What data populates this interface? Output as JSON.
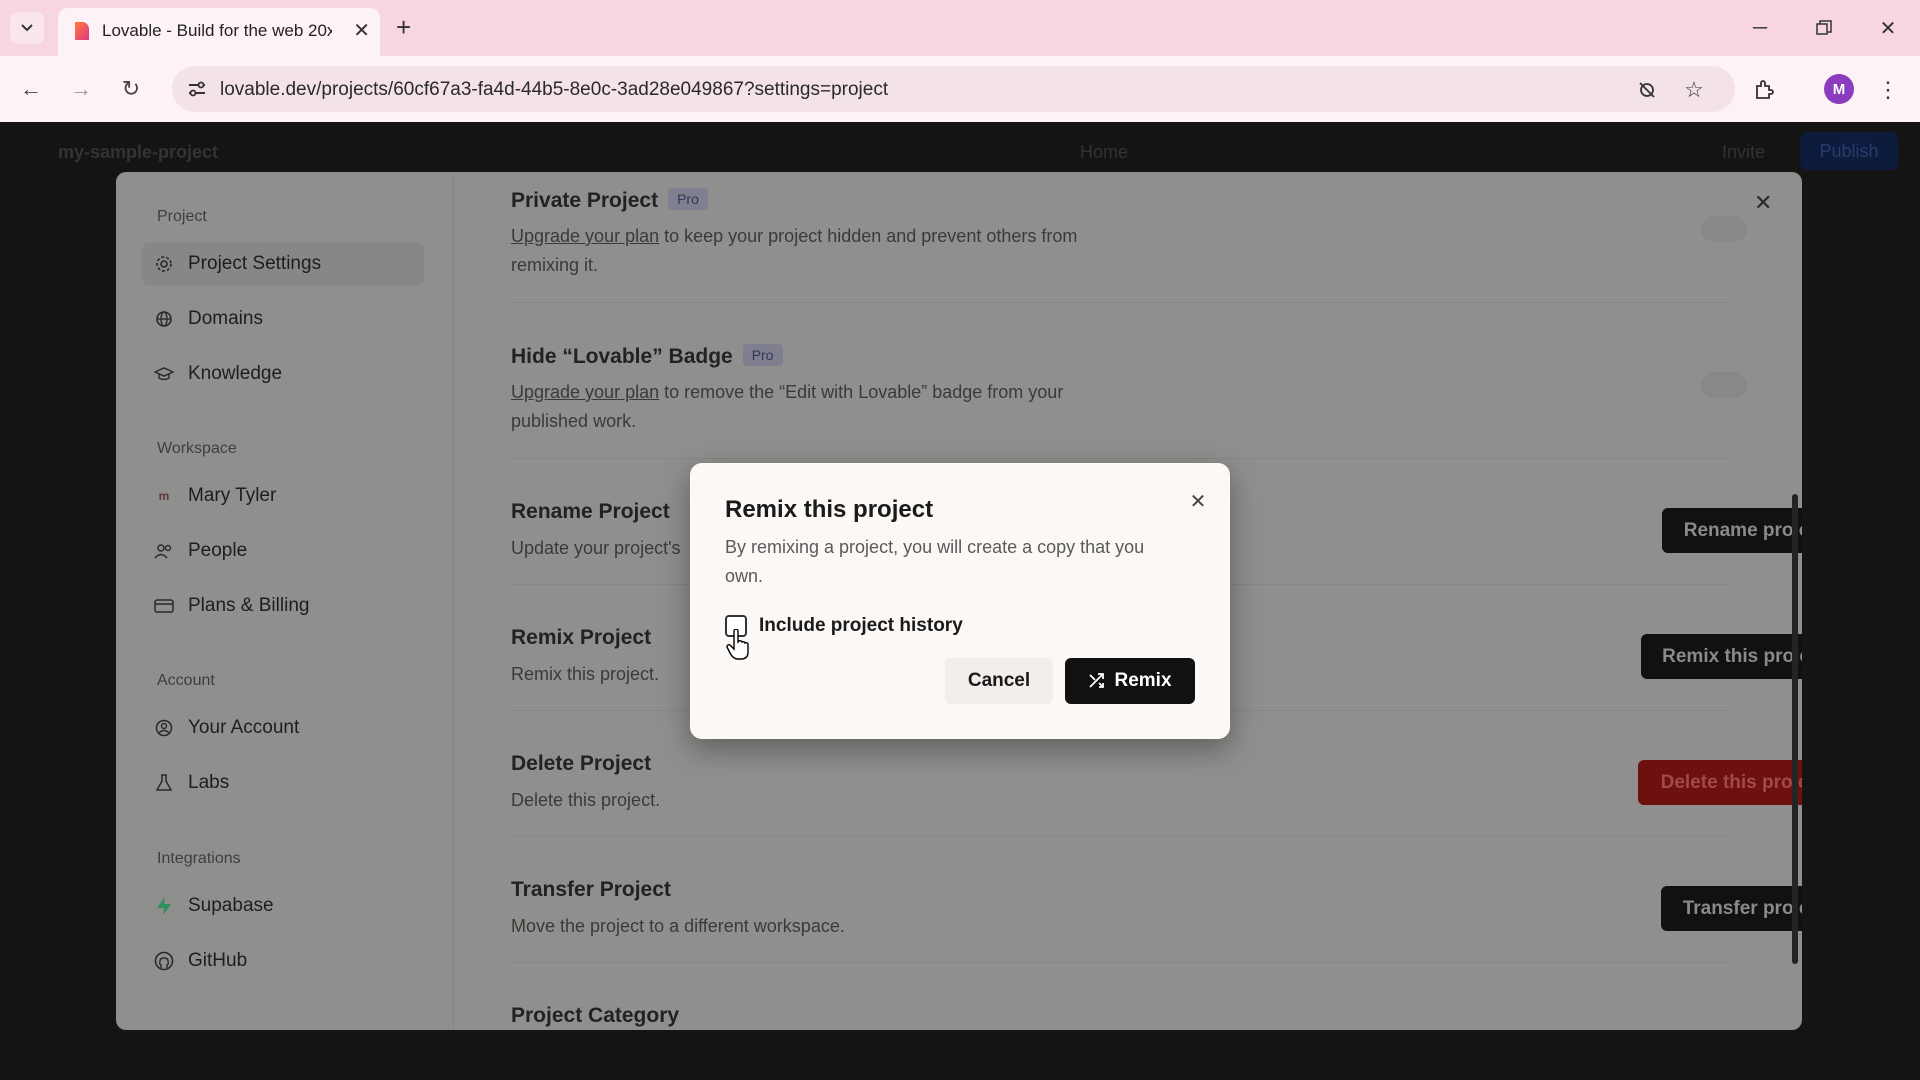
{
  "browser": {
    "tab_title": "Lovable - Build for the web 20x",
    "url": "lovable.dev/projects/60cf67a3-fa4d-44b5-8e0c-3ad28e049867?settings=project",
    "profile_initial": "M"
  },
  "app": {
    "project_name": "my-sample-project",
    "home_label": "Home",
    "invite_label": "Invite",
    "publish_label": "Publish"
  },
  "sidebar": {
    "sections": [
      {
        "title": "Project",
        "items": [
          {
            "label": "Project Settings",
            "icon": "gear-icon",
            "active": true
          },
          {
            "label": "Domains",
            "icon": "globe-icon"
          },
          {
            "label": "Knowledge",
            "icon": "graduation-cap-icon"
          }
        ]
      },
      {
        "title": "Workspace",
        "items": [
          {
            "label": "Mary Tyler",
            "icon": "workspace-avatar-icon"
          },
          {
            "label": "People",
            "icon": "people-icon"
          },
          {
            "label": "Plans & Billing",
            "icon": "credit-card-icon"
          }
        ]
      },
      {
        "title": "Account",
        "items": [
          {
            "label": "Your Account",
            "icon": "user-circle-icon"
          },
          {
            "label": "Labs",
            "icon": "flask-icon"
          }
        ]
      },
      {
        "title": "Integrations",
        "items": [
          {
            "label": "Supabase",
            "icon": "supabase-icon"
          },
          {
            "label": "GitHub",
            "icon": "github-icon"
          }
        ]
      }
    ]
  },
  "settings": {
    "private_project": {
      "title": "Private Project",
      "badge": "Pro",
      "link": "Upgrade your plan",
      "desc_rest": " to keep your project hidden and prevent others from remixing it."
    },
    "hide_badge": {
      "title": "Hide “Lovable” Badge",
      "badge": "Pro",
      "link": "Upgrade your plan",
      "desc_rest": " to remove the “Edit with Lovable” badge from your published work."
    },
    "rename": {
      "title": "Rename Project",
      "desc": "Update your project's",
      "button": "Rename project"
    },
    "remix": {
      "title": "Remix Project",
      "desc": "Remix this project.",
      "button": "Remix this project"
    },
    "delete": {
      "title": "Delete Project",
      "desc": "Delete this project.",
      "button": "Delete this project"
    },
    "transfer": {
      "title": "Transfer Project",
      "desc": "Move the project to a different workspace.",
      "button": "Transfer project"
    },
    "category": {
      "title": "Project Category"
    }
  },
  "dialog": {
    "title": "Remix this project",
    "description": "By remixing a project, you will create a copy that you own.",
    "checkbox_label": "Include project history",
    "checkbox_checked": false,
    "cancel_label": "Cancel",
    "remix_label": "Remix"
  },
  "colors": {
    "accent_dark": "#111111",
    "danger": "#6e0f10",
    "supabase_green": "#3ecf8e"
  }
}
